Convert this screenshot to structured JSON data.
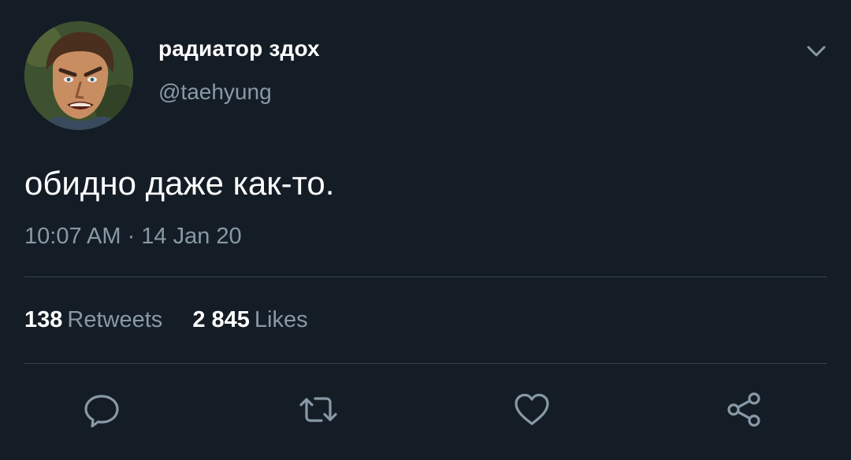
{
  "author": {
    "display_name": "радиатор здох",
    "handle": "@taehyung"
  },
  "tweet": {
    "text": "обидно даже как-то.",
    "timestamp": "10:07 AM · 14 Jan 20"
  },
  "stats": {
    "retweets_count": "138",
    "retweets_label": "Retweets",
    "likes_count": "2 845",
    "likes_label": "Likes"
  },
  "actions": {
    "reply_icon": "reply-icon",
    "retweet_icon": "retweet-icon",
    "like_icon": "heart-icon",
    "share_icon": "share-icon"
  },
  "colors": {
    "background": "#141d26",
    "primary_text": "#ffffff",
    "secondary_text": "#8899a6",
    "divider": "#38444d"
  }
}
